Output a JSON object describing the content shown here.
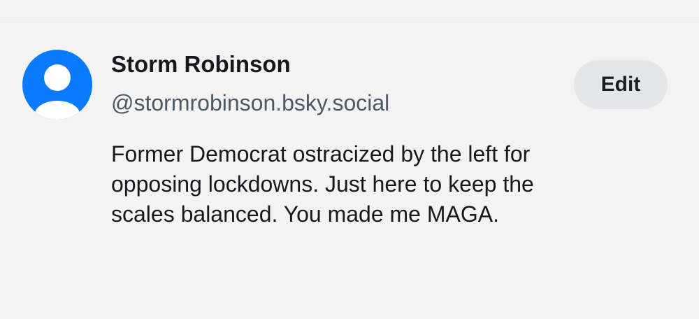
{
  "profile": {
    "display_name": "Storm Robinson",
    "handle": "@stormrobinson.bsky.social",
    "edit_label": "Edit",
    "bio_lines": [
      "Former Democrat ostracized by the left for",
      "opposing lockdowns. Just here to keep the",
      "scales balanced. You made me MAGA."
    ],
    "avatar_icon": "default-user-avatar-icon"
  },
  "colors": {
    "avatar_blue": "#0a7aff",
    "background": "#f3f3f3",
    "handle_gray": "#4b5866",
    "edit_button_bg": "#e4e6ea"
  }
}
